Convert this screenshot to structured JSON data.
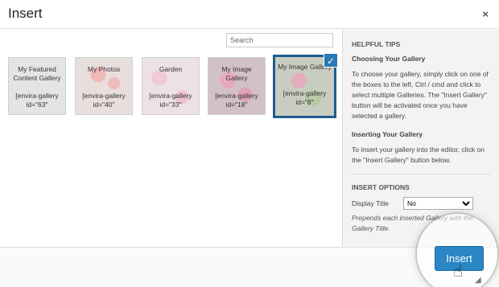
{
  "header": {
    "title": "Insert",
    "close_label": "×"
  },
  "search": {
    "placeholder": "Search"
  },
  "galleries": [
    {
      "title": "My Featured Content Gallery",
      "code": "[envira-gallery id=\"63\"",
      "bg": "#e4e4e4",
      "selected": false
    },
    {
      "title": "My Photos",
      "code": "[envira-gallery id=\"40\"",
      "bg": "#e7dcdc",
      "selected": false
    },
    {
      "title": "Garden",
      "code": "[envira-gallery id=\"33\"",
      "bg": "#ebe0e4",
      "selected": false
    },
    {
      "title": "My Image Gallery",
      "code": "[envira-gallery id=\"18\"",
      "bg": "#d5c2c8",
      "selected": false
    },
    {
      "title": "My Image Gallery",
      "code": "[envira-gallery id=\"8\"",
      "bg": "#c9ccc0",
      "selected": true
    }
  ],
  "checkmark": "✓",
  "sidebar": {
    "helpful_tips_heading": "HELPFUL TIPS",
    "choosing_heading": "Choosing Your Gallery",
    "choosing_text": "To choose your gallery, simply click on one of the boxes to the left. Ctrl / cmd and click to select multiple Galleries. The \"Insert Gallery\" button will be activated once you have selected a gallery.",
    "inserting_heading": "Inserting Your Gallery",
    "inserting_text": "To insert your gallery into the editor, click on the \"Insert Gallery\" button below.",
    "insert_options_heading": "INSERT OPTIONS",
    "display_title_label": "Display Title",
    "display_title_value": "No",
    "display_title_help": "Prepends each inserted Gallery with the Gallery Title."
  },
  "footer": {
    "insert_label": "Insert"
  }
}
